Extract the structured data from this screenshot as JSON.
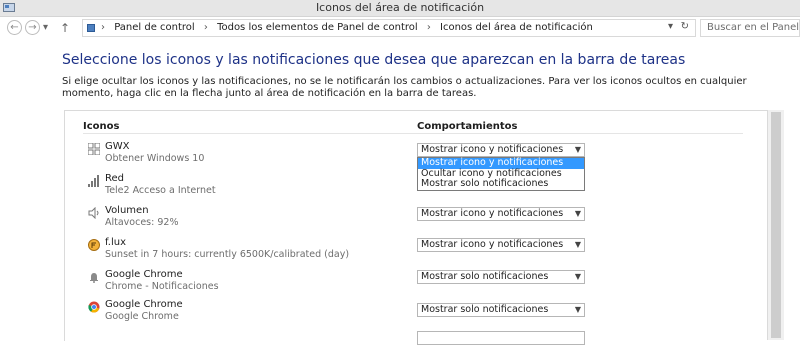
{
  "window": {
    "title": "Iconos del área de notificación"
  },
  "nav": {
    "breadcrumbs": [
      "Panel de control",
      "Todos los elementos de Panel de control",
      "Iconos del área de notificación"
    ],
    "search_placeholder": "Buscar en el Panel de control"
  },
  "page": {
    "heading": "Seleccione los iconos y las notificaciones que desea que aparezcan en la barra de tareas",
    "description": "Si elige ocultar los iconos y las notificaciones, no se le notificarán los cambios o actualizaciones. Para ver los iconos ocultos en cualquier momento, haga clic en la flecha junto al área de notificación en la barra de tareas."
  },
  "table": {
    "col_icons": "Iconos",
    "col_behaviors": "Comportamientos",
    "rows": [
      {
        "name": "GWX",
        "sub": "Obtener Windows 10",
        "behavior": "Mostrar icono y notificaciones",
        "icon": "windows-icon"
      },
      {
        "name": "Red",
        "sub": "Tele2 Acceso a Internet",
        "behavior": "",
        "icon": "network-signal-icon"
      },
      {
        "name": "Volumen",
        "sub": "Altavoces: 92%",
        "behavior": "Mostrar icono y notificaciones",
        "icon": "speaker-icon"
      },
      {
        "name": "f.lux",
        "sub": "Sunset in 7 hours: currently 6500K/calibrated (day)",
        "behavior": "Mostrar icono y notificaciones",
        "icon": "flux-icon"
      },
      {
        "name": "Google Chrome",
        "sub": "Chrome - Notificaciones",
        "behavior": "Mostrar solo notificaciones",
        "icon": "bell-icon"
      },
      {
        "name": "Google Chrome",
        "sub": "Google Chrome",
        "behavior": "Mostrar solo notificaciones",
        "icon": "chrome-icon"
      }
    ]
  },
  "dropdown_options": [
    "Mostrar icono y notificaciones",
    "Ocultar icono y notificaciones",
    "Mostrar solo notificaciones"
  ],
  "colors": {
    "heading": "#1e3287",
    "selection": "#3399ff"
  }
}
